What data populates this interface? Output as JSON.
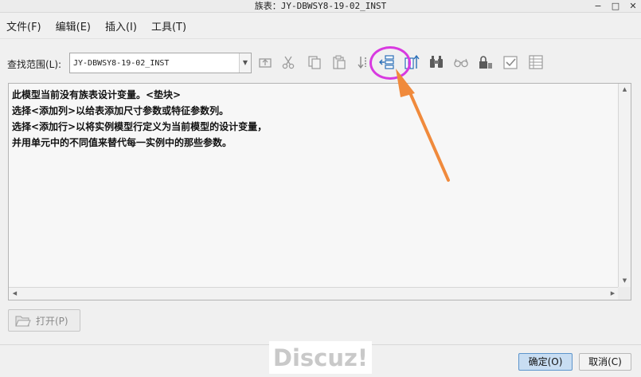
{
  "window": {
    "title": "族表：JY-DBWSY8-19-02_INST",
    "minimize": "−",
    "maximize": "□",
    "close": "✕"
  },
  "menu": [
    "文件(F)",
    "编辑(E)",
    "插入(I)",
    "工具(T)"
  ],
  "toolbar": {
    "scope_label": "查找范围(L):",
    "scope_value": "JY-DBWSY8-19-02_INST",
    "dropdown_arrow": "▼",
    "tools": [
      "up-level-icon",
      "cut-icon",
      "copy-icon",
      "paste-icon",
      "insert-row-icon",
      "add-column-icon",
      "add-item-icon",
      "find-binoculars-icon",
      "glasses-icon",
      "lock-icon",
      "verify-checkbox-icon",
      "table-grid-icon"
    ]
  },
  "text_panel": {
    "lines": [
      "此模型当前没有族表设计变量。<垫块>",
      "选择<添加列>以给表添加尺寸参数或特征参数列。",
      "选择<添加行>以将实例模型行定义为当前模型的设计变量，",
      "并用单元中的不同值来替代每一实例中的那些参数。"
    ]
  },
  "scroll": {
    "up": "▲",
    "down": "▼",
    "left": "◀",
    "right": "▶"
  },
  "buttons": {
    "open": "打开(P)",
    "ok": "确定(O)",
    "cancel": "取消(C)"
  },
  "watermark": "Discuz!",
  "colors": {
    "highlight_circle": "#d83ae0",
    "arrow": "#f08a3c",
    "ok_button": "#c8ddf2"
  }
}
